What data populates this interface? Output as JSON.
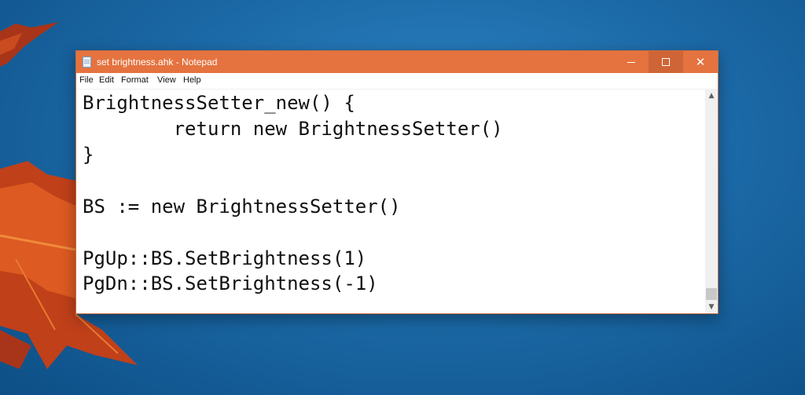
{
  "window": {
    "title": "set brightness.ahk - Notepad",
    "title_bar_color": "#e5733f"
  },
  "menu": {
    "file": "File",
    "edit": "Edit",
    "format": "Format",
    "view": "View",
    "help": "Help"
  },
  "editor": {
    "lines": [
      "BrightnessSetter_new() {",
      "        return new BrightnessSetter()",
      "}",
      "",
      "BS := new BrightnessSetter()",
      "",
      "PgUp::BS.SetBrightness(1)",
      "PgDn::BS.SetBrightness(-1)"
    ]
  },
  "icons": {
    "app": "notepad-icon",
    "minimize": "minimize-icon",
    "maximize": "maximize-icon",
    "close": "close-icon",
    "scroll_up": "scroll-up-icon",
    "scroll_down": "scroll-down-icon"
  },
  "glyphs": {
    "close": "✕",
    "scroll_up": "▲",
    "scroll_down": "▼"
  }
}
